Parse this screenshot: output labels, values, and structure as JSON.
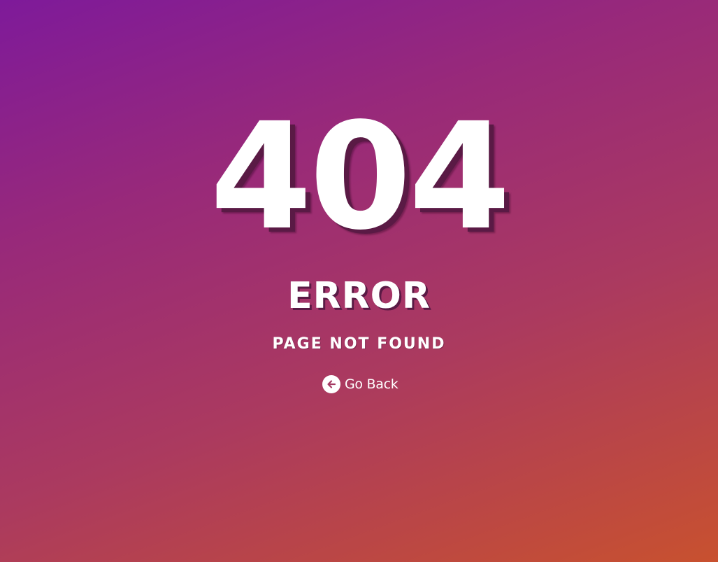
{
  "error_page": {
    "code": "404",
    "title": "ERROR",
    "subtitle": "PAGE NOT FOUND",
    "back_link": {
      "label": "Go Back",
      "icon": "arrow-left-circle-icon"
    }
  },
  "colors": {
    "gradient_start": "#7e1a9a",
    "gradient_end": "#c8512f",
    "text": "#ffffff",
    "shadow": "#5a1a45"
  }
}
